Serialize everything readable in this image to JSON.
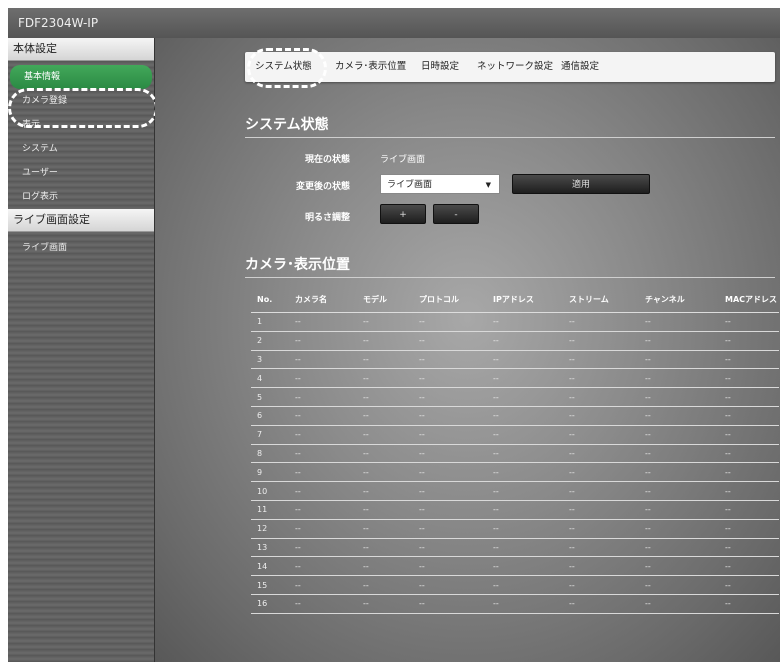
{
  "app": {
    "title": "FDF2304W-IP"
  },
  "sidebar": {
    "section1": "本体設定",
    "items": [
      {
        "label": "基本情報"
      },
      {
        "label": "カメラ登録"
      },
      {
        "label": "表示"
      },
      {
        "label": "システム"
      },
      {
        "label": "ユーザー"
      },
      {
        "label": "ログ表示"
      }
    ],
    "section2": "ライブ画面設定",
    "items2": [
      {
        "label": "ライブ画面"
      }
    ]
  },
  "tabs": [
    {
      "label": "システム状態"
    },
    {
      "label": "カメラ･表示位置"
    },
    {
      "label": "日時設定"
    },
    {
      "label": "ネットワーク設定"
    },
    {
      "label": "通信設定"
    }
  ],
  "system": {
    "heading": "システム状態",
    "current_label": "現在の状態",
    "current_value": "ライブ画面",
    "change_label": "変更後の状態",
    "change_value": "ライブ画面",
    "apply": "適用",
    "brightness_label": "明るさ調整",
    "plus": "+",
    "minus": "-"
  },
  "camera": {
    "heading": "カメラ･表示位置",
    "columns": [
      "No.",
      "カメラ名",
      "モデル",
      "プロトコル",
      "IPアドレス",
      "ストリーム",
      "チャンネル",
      "MACアドレス"
    ],
    "dash": "--",
    "rows": [
      "1",
      "2",
      "3",
      "4",
      "5",
      "6",
      "7",
      "8",
      "9",
      "10",
      "11",
      "12",
      "13",
      "14",
      "15",
      "16"
    ]
  }
}
